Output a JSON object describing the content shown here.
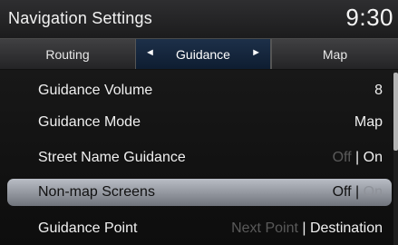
{
  "header": {
    "title": "Navigation Settings",
    "clock": "9:30"
  },
  "tabs": [
    {
      "label": "Routing"
    },
    {
      "label": "Guidance"
    },
    {
      "label": "Map"
    }
  ],
  "tab_arrows": {
    "left": "◄",
    "right": "►"
  },
  "settings": [
    {
      "label": "Guidance Volume",
      "value": "8"
    },
    {
      "label": "Guidance Mode",
      "value": "Map"
    },
    {
      "label": "Street Name Guidance",
      "option_a": "Off",
      "sep": " | ",
      "option_b": "On"
    },
    {
      "label": "Non-map Screens",
      "option_a": "Off",
      "sep": " | ",
      "option_b": "On"
    },
    {
      "label": "Guidance Point",
      "option_a": "Next Point",
      "sep": " | ",
      "option_b": "Destination"
    }
  ],
  "colors": {
    "active_tab": "#1d3049",
    "selected_row": "#b9bdc5"
  }
}
